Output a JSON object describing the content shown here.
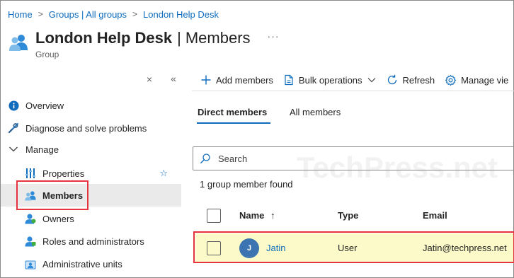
{
  "breadcrumb": {
    "items": [
      "Home",
      "Groups | All groups",
      "London Help Desk"
    ],
    "separator": ">"
  },
  "header": {
    "title": "London Help Desk",
    "separator": "|",
    "section": "Members",
    "more": "···",
    "subtitle": "Group"
  },
  "sidebar": {
    "close": "×",
    "collapse": "«",
    "items": [
      {
        "label": "Overview",
        "icon": "info-icon"
      },
      {
        "label": "Diagnose and solve problems",
        "icon": "wrench-icon"
      },
      {
        "label": "Manage",
        "icon": "chevron-down-icon"
      },
      {
        "label": "Properties",
        "icon": "properties-icon",
        "favorite": "☆"
      },
      {
        "label": "Members",
        "icon": "members-icon",
        "selected": true
      },
      {
        "label": "Owners",
        "icon": "owners-icon"
      },
      {
        "label": "Roles and administrators",
        "icon": "roles-icon"
      },
      {
        "label": "Administrative units",
        "icon": "admin-units-icon"
      }
    ]
  },
  "toolbar": {
    "add_members": "Add members",
    "bulk_operations": "Bulk operations",
    "refresh": "Refresh",
    "manage_view": "Manage vie"
  },
  "tabs": {
    "direct": "Direct members",
    "all": "All members",
    "active": "direct"
  },
  "search": {
    "placeholder": "Search"
  },
  "results": {
    "count_text": "1 group member found"
  },
  "table": {
    "columns": {
      "name": "Name",
      "sort_indicator": "↑",
      "type": "Type",
      "email": "Email"
    },
    "rows": [
      {
        "initial": "J",
        "name": "Jatin",
        "type": "User",
        "email": "Jatin@techpress.net"
      }
    ]
  },
  "watermark": "TechPress.net",
  "colors": {
    "accent": "#0f6cbd",
    "highlight_border": "#e5343e",
    "row_highlight": "#fcfac8",
    "avatar": "#3b74b0"
  }
}
